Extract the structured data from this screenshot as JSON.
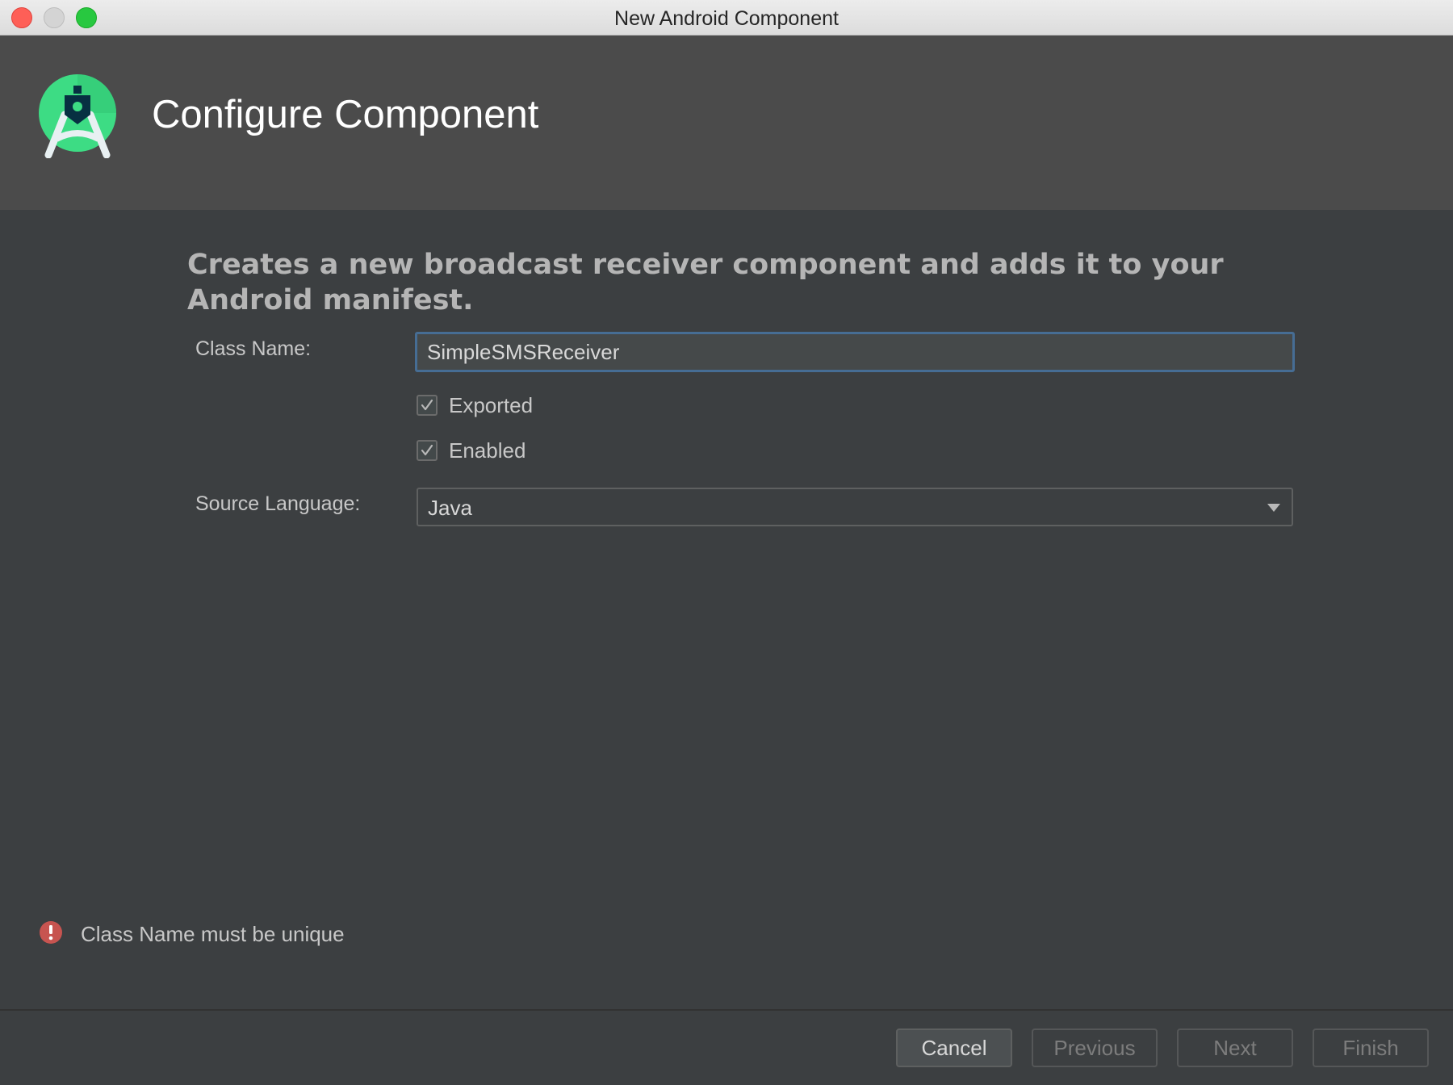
{
  "window": {
    "title": "New Android Component"
  },
  "header": {
    "title": "Configure Component",
    "logo_icon": "android-studio-logo-icon"
  },
  "form": {
    "description": "Creates a new broadcast receiver component and adds it to your Android manifest.",
    "class_name_label": "Class Name:",
    "class_name_value": "SimpleSMSReceiver",
    "exported": {
      "label": "Exported",
      "checked": true
    },
    "enabled": {
      "label": "Enabled",
      "checked": true
    },
    "source_language_label": "Source Language:",
    "source_language_value": "Java"
  },
  "validation": {
    "message": "Class Name must be unique",
    "icon": "error-icon",
    "color": "#c75450"
  },
  "footer": {
    "cancel_label": "Cancel",
    "previous_label": "Previous",
    "next_label": "Next",
    "finish_label": "Finish"
  },
  "colors": {
    "accent_focus": "#466d94",
    "logo_green": "#3ddc84"
  }
}
